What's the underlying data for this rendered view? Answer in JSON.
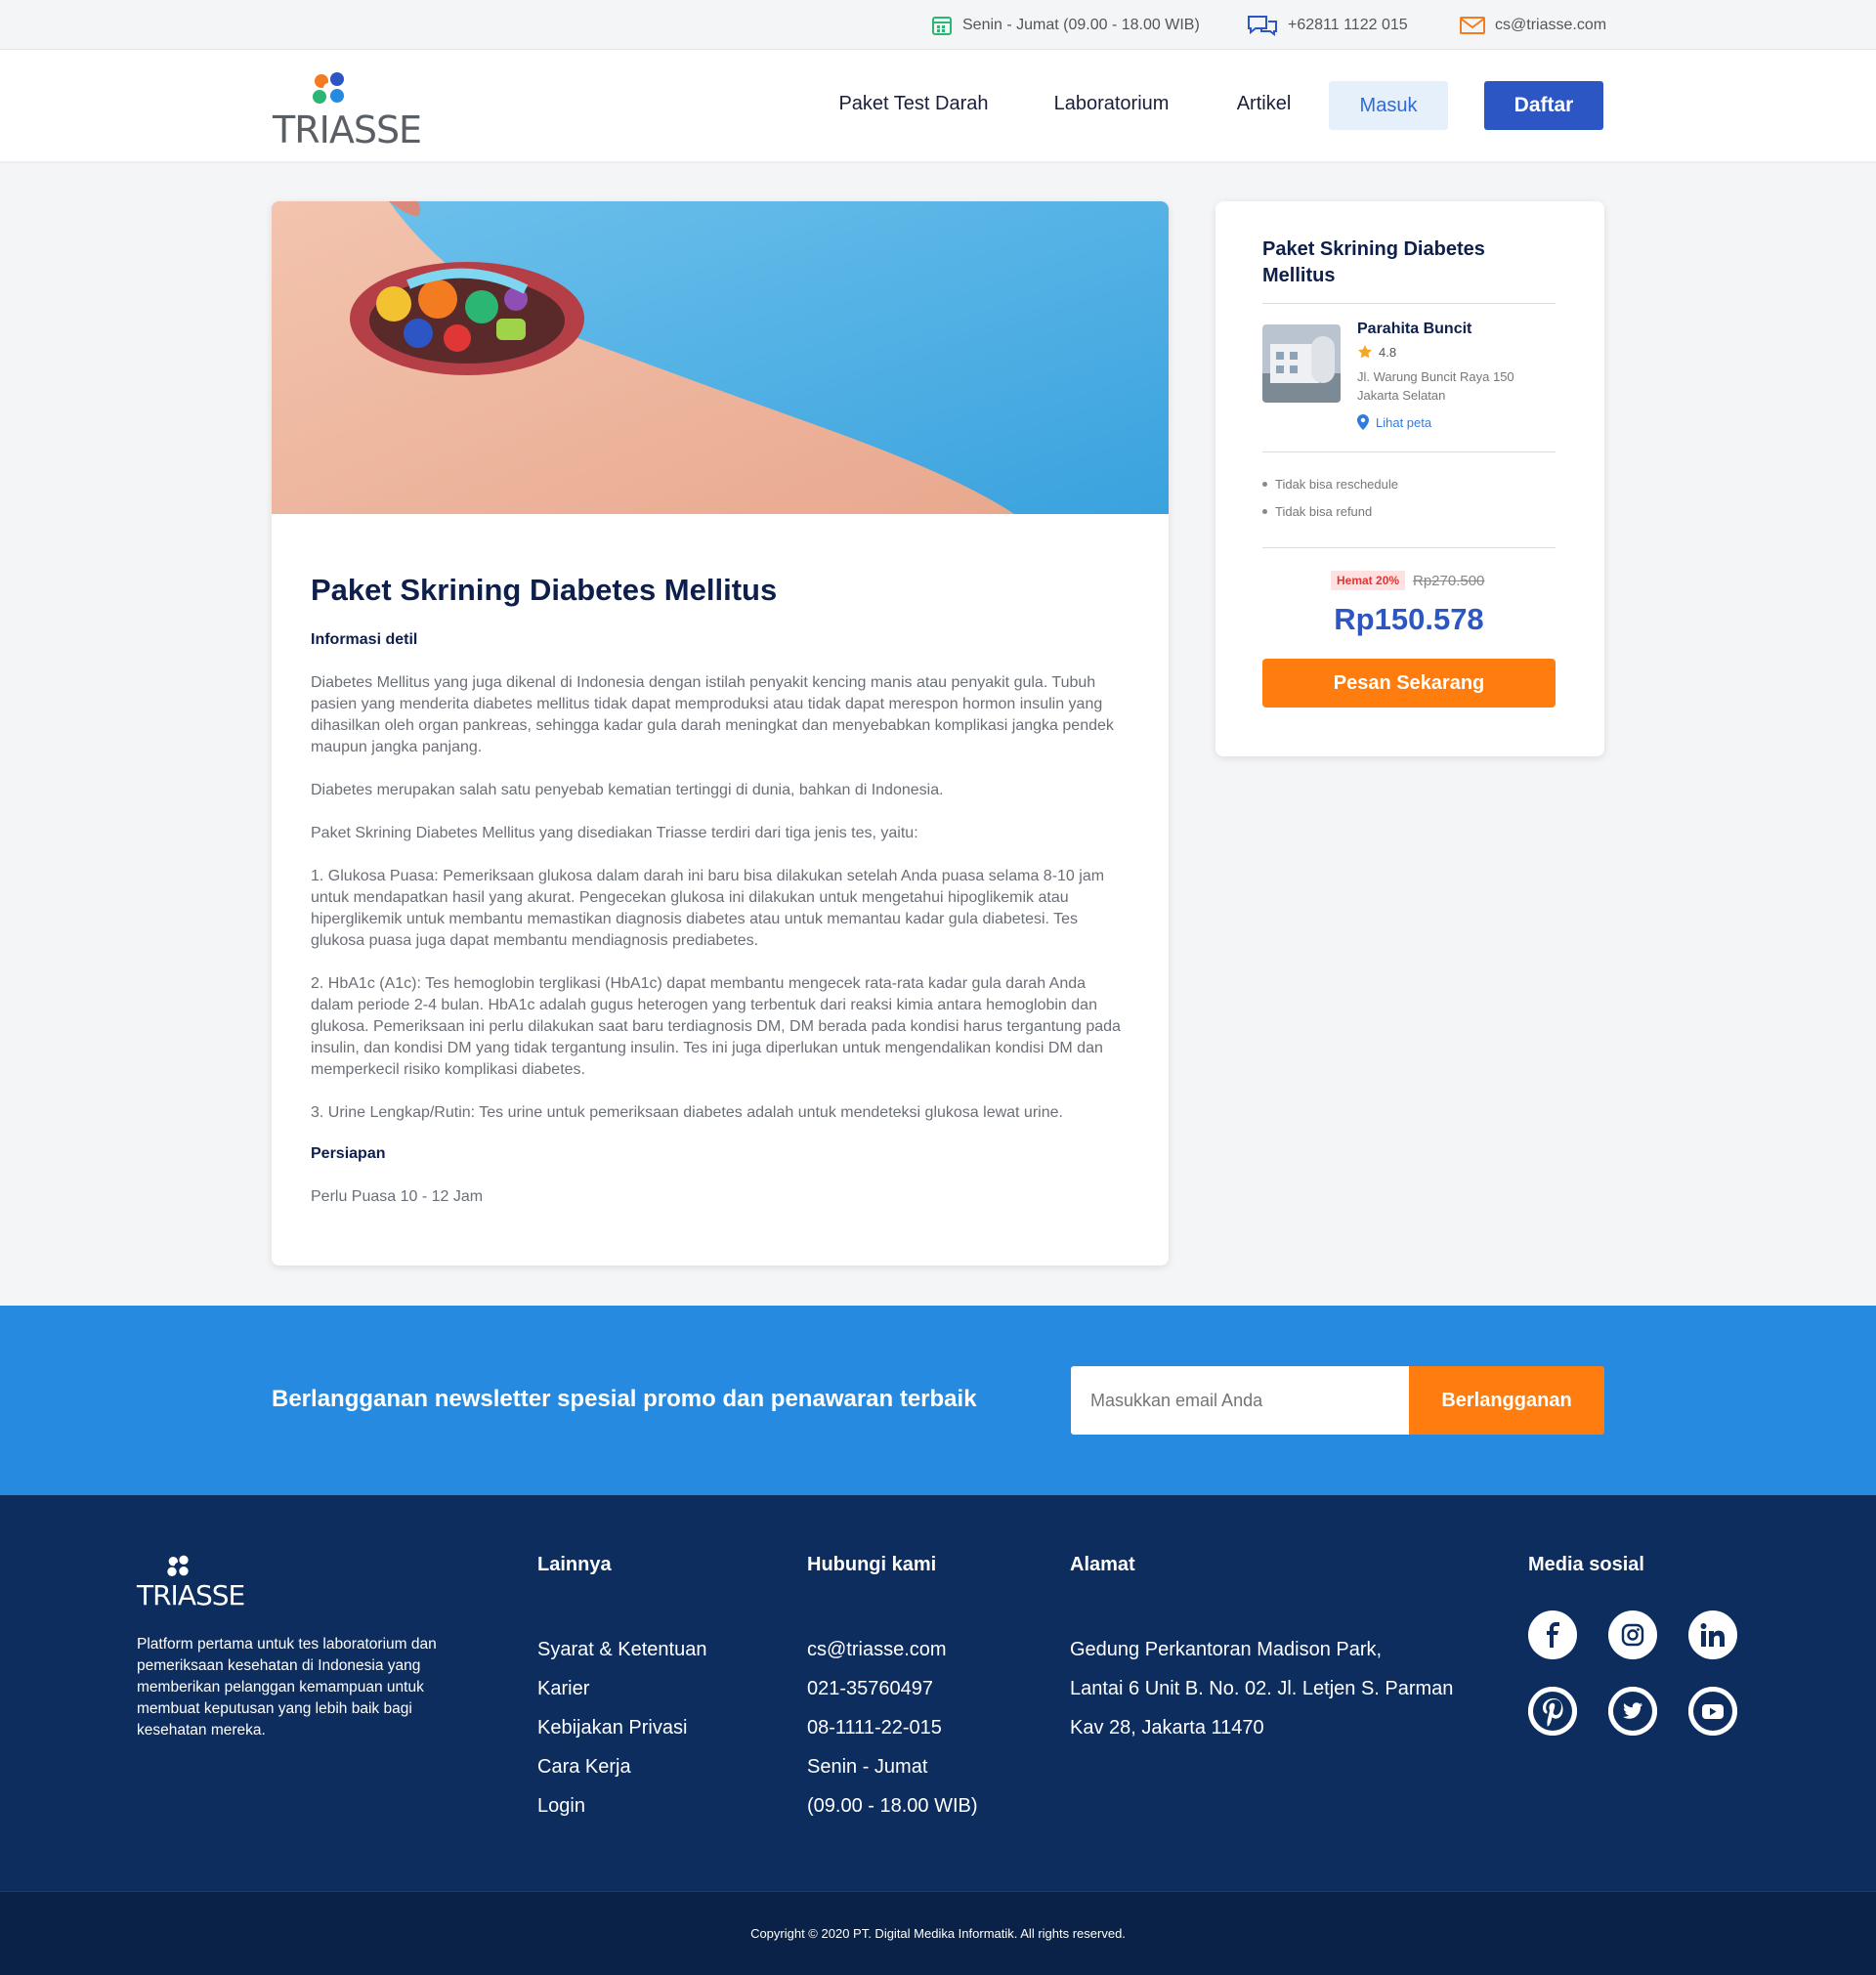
{
  "topbar": {
    "hours": "Senin - Jumat (09.00 - 18.00 WIB)",
    "phone": "+62811 1122 015",
    "email": "cs@triasse.com"
  },
  "header": {
    "brand": "TRIASSE",
    "nav": [
      "Paket Test Darah",
      "Laboratorium",
      "Artikel"
    ],
    "login": "Masuk",
    "register": "Daftar"
  },
  "article": {
    "title": "Paket Skrining Diabetes Mellitus",
    "detail_heading": "Informasi detil",
    "paragraphs": [
      "Diabetes Mellitus yang juga dikenal di Indonesia dengan istilah penyakit kencing manis atau penyakit gula. Tubuh pasien yang menderita diabetes mellitus tidak dapat memproduksi atau tidak dapat merespon hormon insulin yang dihasilkan oleh organ pankreas, sehingga kadar gula darah meningkat dan menyebabkan komplikasi jangka pendek maupun jangka panjang.",
      "Diabetes merupakan salah satu  penyebab kematian tertinggi di dunia, bahkan di Indonesia.",
      "Paket Skrining Diabetes Mellitus yang disediakan Triasse terdiri dari tiga jenis tes, yaitu:",
      "1. Glukosa Puasa: Pemeriksaan glukosa dalam darah ini baru bisa dilakukan setelah Anda puasa selama 8-10 jam untuk mendapatkan hasil yang akurat. Pengecekan glukosa ini dilakukan untuk mengetahui hipoglikemik atau hiperglikemik untuk membantu memastikan diagnosis diabetes atau untuk memantau kadar gula diabetesi. Tes glukosa puasa juga dapat membantu mendiagnosis prediabetes.",
      "2. HbA1c (A1c): Tes hemoglobin terglikasi (HbA1c) dapat membantu mengecek rata-rata kadar gula darah Anda dalam periode 2-4 bulan. HbA1c adalah gugus heterogen yang terbentuk dari reaksi kimia antara hemoglobin dan glukosa. Pemeriksaan ini perlu dilakukan saat baru terdiagnosis DM, DM berada pada kondisi harus tergantung pada insulin, dan kondisi DM yang tidak tergantung insulin. Tes ini juga diperlukan untuk mengendalikan kondisi DM dan memperkecil risiko komplikasi diabetes.",
      "3. Urine Lengkap/Rutin: Tes urine untuk pemeriksaan diabetes adalah untuk mendeteksi glukosa lewat urine."
    ],
    "prep_heading": "Persiapan",
    "prep_text": "Perlu Puasa 10 - 12 Jam"
  },
  "order": {
    "title": "Paket Skrining Diabetes Mellitus",
    "lab_name": "Parahita Buncit",
    "rating": "4.8",
    "address_line1": "Jl. Warung Buncit Raya 150",
    "address_line2": "Jakarta Selatan",
    "map_link": "Lihat peta",
    "rules": [
      "Tidak bisa reschedule",
      "Tidak bisa refund"
    ],
    "discount_badge": "Hemat 20%",
    "old_price": "Rp270.500",
    "price": "Rp150.578",
    "cta": "Pesan Sekarang"
  },
  "newsletter": {
    "text": "Berlangganan newsletter spesial promo dan penawaran terbaik",
    "placeholder": "Masukkan email Anda",
    "button": "Berlangganan"
  },
  "footer": {
    "brand": "TRIASSE",
    "description": "Platform pertama untuk tes laboratorium dan pemeriksaan kesehatan di Indonesia yang memberikan pelanggan kemampuan untuk membuat keputusan yang lebih baik bagi kesehatan mereka.",
    "col_other": {
      "heading": "Lainnya",
      "items": [
        "Syarat & Ketentuan",
        "Karier",
        "Kebijakan Privasi",
        "Cara Kerja",
        "Login"
      ]
    },
    "col_contact": {
      "heading": "Hubungi kami",
      "items": [
        "cs@triasse.com",
        "021-35760497",
        "08-1111-22-015",
        "Senin - Jumat",
        "(09.00 - 18.00 WIB)"
      ]
    },
    "col_address": {
      "heading": "Alamat",
      "items": [
        "Gedung Perkantoran Madison Park,",
        "Lantai 6 Unit B. No. 02. Jl. Letjen S. Parman",
        "Kav 28, Jakarta 11470"
      ]
    },
    "social_heading": "Media sosial",
    "social_icons": [
      "facebook-icon",
      "instagram-icon",
      "linkedin-icon",
      "pinterest-icon",
      "twitter-icon",
      "youtube-icon"
    ],
    "copyright": "Copyright © 2020 PT. Digital Medika Informatik. All rights reserved."
  },
  "colors": {
    "brand_blue": "#2c56c4",
    "cta_orange": "#ff7d0e",
    "newsletter_blue": "#268be0",
    "footer_navy": "#0d2d5e"
  }
}
